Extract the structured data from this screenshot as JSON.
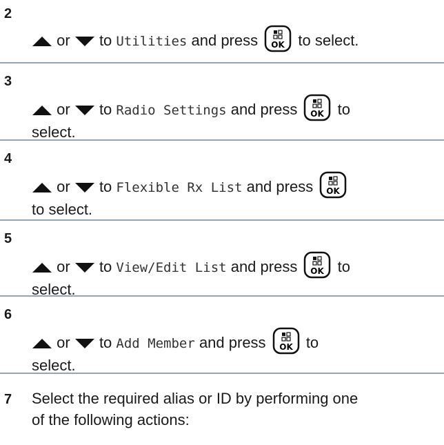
{
  "steps": [
    {
      "number": "2",
      "text_or": "or",
      "text_to": "to",
      "menu": "Utilities",
      "text_press": "and press",
      "text_after": "to select."
    },
    {
      "number": "3",
      "text_or": "or",
      "text_to": "to",
      "menu": "Radio Settings",
      "text_press": "and press",
      "text_after": "to",
      "text_wrap": "select."
    },
    {
      "number": "4",
      "text_or": "or",
      "text_to": "to",
      "menu": "Flexible Rx List",
      "text_press": "and press",
      "text_wrap": "to select."
    },
    {
      "number": "5",
      "text_or": "or",
      "text_to": "to",
      "menu": "View/Edit List",
      "text_press": "and press",
      "text_after": "to",
      "text_wrap": "select."
    },
    {
      "number": "6",
      "text_or": "or",
      "text_to": "to",
      "menu": "Add Member",
      "text_press": "and press",
      "text_after": "to",
      "text_wrap": "select."
    },
    {
      "number": "7",
      "line1": "Select the required alias or ID by performing one",
      "line2": "of the following actions:"
    }
  ],
  "ok_key": {
    "label": "OK",
    "icon": "ok-menu-key-icon"
  },
  "colors": {
    "divider": "#94a4b5",
    "text": "#1a1a1a"
  }
}
